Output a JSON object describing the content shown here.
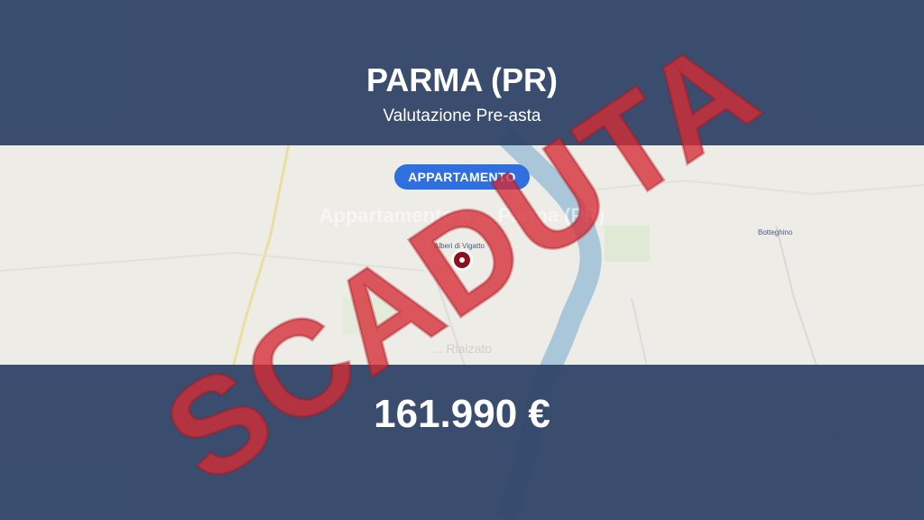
{
  "header": {
    "city": "PARMA (PR)",
    "subtitle": "Valutazione Pre-asta"
  },
  "listing": {
    "type_badge": "APPARTAMENTO",
    "title_faded": "Appartamento a ... Parma (PR)",
    "detail_faded": "... Rialzato"
  },
  "map": {
    "labels": {
      "pin_place": "Alberi di Vigatto",
      "place_right": "Botteghino"
    },
    "pin_color": "#8e1020",
    "river_color": "#aac8d8"
  },
  "price": "161.990 €",
  "stamp": {
    "text": "SCADUTA",
    "color": "#d62c34"
  },
  "colors": {
    "band": "#32466a",
    "badge": "#2f6fe0"
  }
}
